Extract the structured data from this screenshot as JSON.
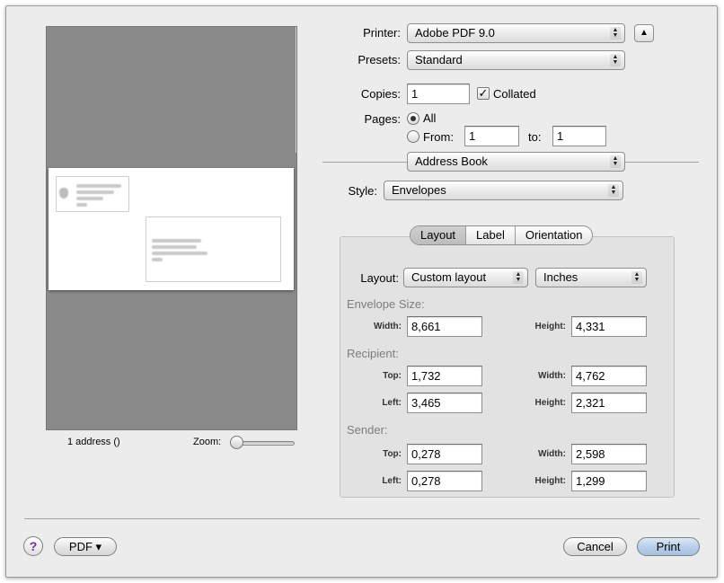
{
  "printer": {
    "label": "Printer:",
    "value": "Adobe PDF 9.0",
    "eject_icon": "eject-icon"
  },
  "presets": {
    "label": "Presets:",
    "value": "Standard"
  },
  "copies": {
    "label": "Copies:",
    "value": "1",
    "collated_label": "Collated",
    "collated_checked": true
  },
  "pages": {
    "label": "Pages:",
    "all_label": "All",
    "from_label": "From:",
    "from_value": "1",
    "to_label": "to:",
    "to_value": "1"
  },
  "panel": {
    "value": "Address Book"
  },
  "style": {
    "label": "Style:",
    "value": "Envelopes"
  },
  "tabs": [
    {
      "label": "Layout",
      "active": true
    },
    {
      "label": "Label"
    },
    {
      "label": "Orientation"
    }
  ],
  "layout": {
    "label": "Layout:",
    "layout_value": "Custom layout",
    "units_value": "Inches",
    "envelope_size": {
      "title": "Envelope Size:",
      "width_label": "Width:",
      "width": "8,661",
      "height_label": "Height:",
      "height": "4,331"
    },
    "recipient": {
      "title": "Recipient:",
      "top_label": "Top:",
      "top": "1,732",
      "width_label": "Width:",
      "width": "4,762",
      "left_label": "Left:",
      "left": "3,465",
      "height_label": "Height:",
      "height": "2,321"
    },
    "sender": {
      "title": "Sender:",
      "top_label": "Top:",
      "top": "0,278",
      "width_label": "Width:",
      "width": "2,598",
      "left_label": "Left:",
      "left": "0,278",
      "height_label": "Height:",
      "height": "1,299"
    }
  },
  "preview": {
    "address_count": "1 address ()",
    "zoom_label": "Zoom:"
  },
  "footer": {
    "help_label": "?",
    "pdf_label": "PDF ▾",
    "cancel_label": "Cancel",
    "print_label": "Print"
  }
}
